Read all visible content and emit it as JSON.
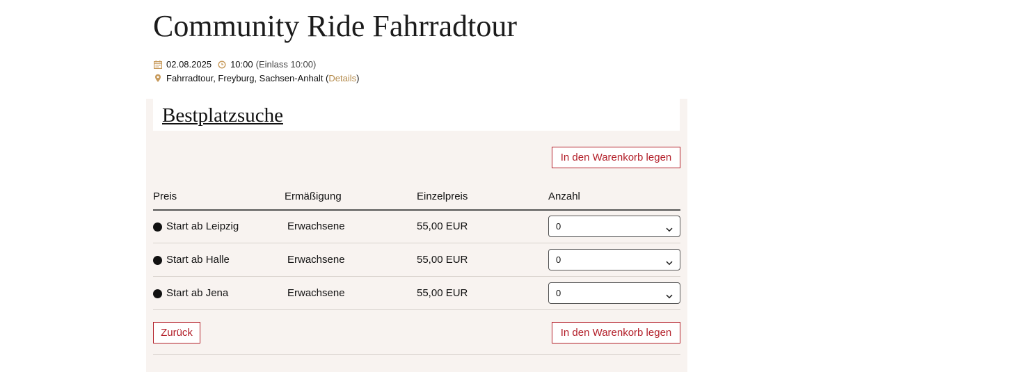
{
  "event": {
    "title": "Community Ride Fahrradtour",
    "date": "02.08.2025",
    "time": "10:00",
    "admission": "(Einlass 10:00)",
    "location": "Fahrradtour, Freyburg, Sachsen-Anhalt (",
    "details_link": "Details",
    "location_close": ")",
    "icons": {
      "date": "calendar-icon",
      "time": "clock-icon",
      "location": "map-pin-icon"
    },
    "accent_color": "#b48a4a"
  },
  "booking": {
    "heading": "Bestplatzsuche",
    "add_to_cart_label": "In den Warenkorb legen",
    "back_label": "Zurück",
    "button_color": "#b3202a",
    "columns": [
      "Preis",
      "Ermäßigung",
      "Einzelpreis",
      "Anzahl"
    ],
    "rows": [
      {
        "name": "Start ab Leipzig",
        "discount": "Erwachsene",
        "price": "55,00 EUR",
        "quantity": "0"
      },
      {
        "name": "Start ab Halle",
        "discount": "Erwachsene",
        "price": "55,00 EUR",
        "quantity": "0"
      },
      {
        "name": "Start ab Jena",
        "discount": "Erwachsene",
        "price": "55,00 EUR",
        "quantity": "0"
      }
    ]
  }
}
